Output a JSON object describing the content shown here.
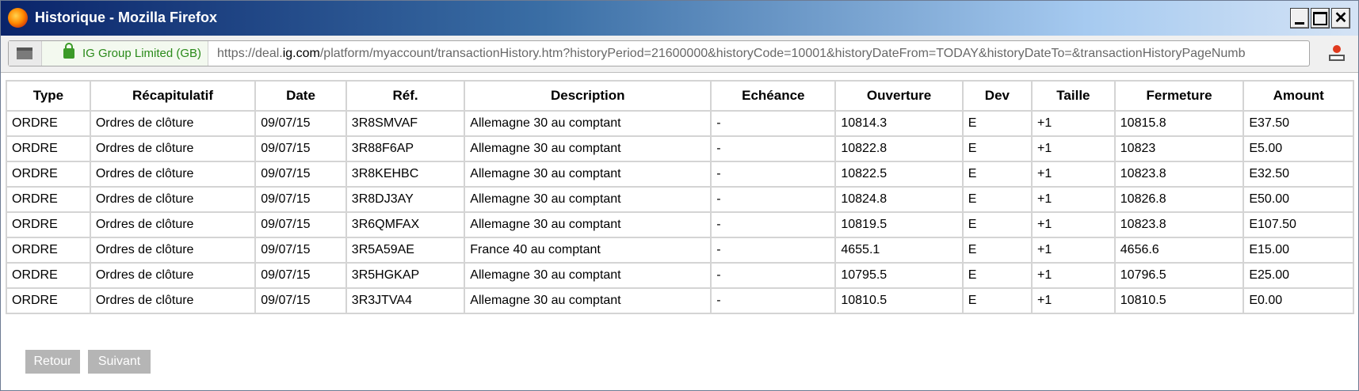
{
  "window": {
    "title": "Historique - Mozilla Firefox"
  },
  "urlbar": {
    "identity": "IG Group Limited (GB)",
    "url_prefix": "https://deal.",
    "url_host": "ig.com",
    "url_rest": "/platform/myaccount/transactionHistory.htm?historyPeriod=21600000&historyCode=10001&historyDateFrom=TODAY&historyDateTo=&transactionHistoryPageNumb"
  },
  "table": {
    "headers": [
      "Type",
      "Récapitulatif",
      "Date",
      "Réf.",
      "Description",
      "Echéance",
      "Ouverture",
      "Dev",
      "Taille",
      "Fermeture",
      "Amount"
    ],
    "rows": [
      [
        "ORDRE",
        "Ordres de clôture",
        "09/07/15",
        "3R8SMVAF",
        "Allemagne 30 au comptant",
        "-",
        "10814.3",
        "E",
        "+1",
        "10815.8",
        "E37.50"
      ],
      [
        "ORDRE",
        "Ordres de clôture",
        "09/07/15",
        "3R88F6AP",
        "Allemagne 30 au comptant",
        "-",
        "10822.8",
        "E",
        "+1",
        "10823",
        "E5.00"
      ],
      [
        "ORDRE",
        "Ordres de clôture",
        "09/07/15",
        "3R8KEHBC",
        "Allemagne 30 au comptant",
        "-",
        "10822.5",
        "E",
        "+1",
        "10823.8",
        "E32.50"
      ],
      [
        "ORDRE",
        "Ordres de clôture",
        "09/07/15",
        "3R8DJ3AY",
        "Allemagne 30 au comptant",
        "-",
        "10824.8",
        "E",
        "+1",
        "10826.8",
        "E50.00"
      ],
      [
        "ORDRE",
        "Ordres de clôture",
        "09/07/15",
        "3R6QMFAX",
        "Allemagne 30 au comptant",
        "-",
        "10819.5",
        "E",
        "+1",
        "10823.8",
        "E107.50"
      ],
      [
        "ORDRE",
        "Ordres de clôture",
        "09/07/15",
        "3R5A59AE",
        "France 40 au comptant",
        "-",
        "4655.1",
        "E",
        "+1",
        "4656.6",
        "E15.00"
      ],
      [
        "ORDRE",
        "Ordres de clôture",
        "09/07/15",
        "3R5HGKAP",
        "Allemagne 30 au comptant",
        "-",
        "10795.5",
        "E",
        "+1",
        "10796.5",
        "E25.00"
      ],
      [
        "ORDRE",
        "Ordres de clôture",
        "09/07/15",
        "3R3JTVA4",
        "Allemagne 30 au comptant",
        "-",
        "10810.5",
        "E",
        "+1",
        "10810.5",
        "E0.00"
      ]
    ]
  },
  "pagination": {
    "back_label": "Retour",
    "next_label": "Suivant"
  }
}
